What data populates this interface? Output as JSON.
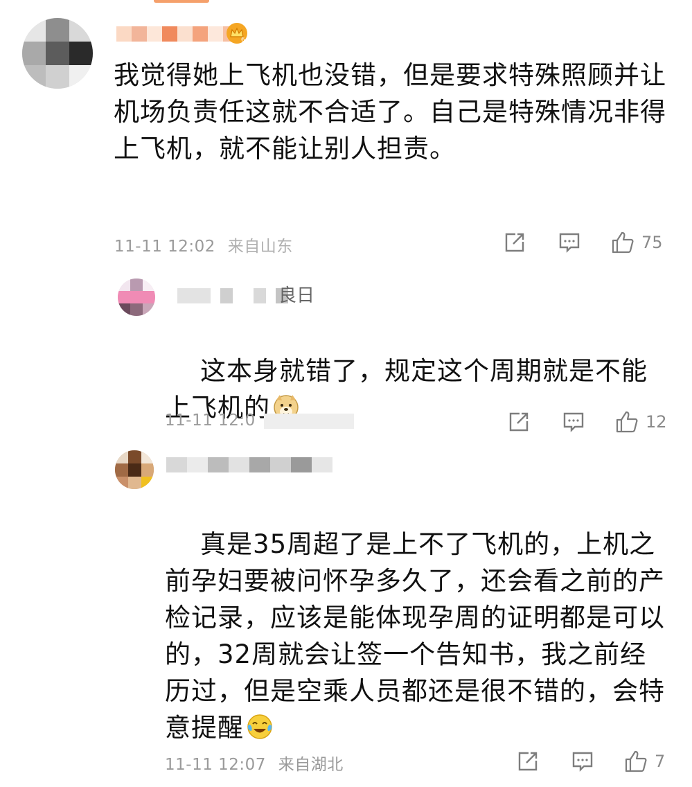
{
  "comments": [
    {
      "text": "我觉得她上飞机也没错，但是要求特殊照顾并让机场负责任这就不合适了。自己是特殊情况非得上飞机，就不能让别人担责。",
      "time": "11-11 12:02",
      "location": "来自山东",
      "likes": "75"
    },
    {
      "name_visible": "良日",
      "text": "这本身就错了，规定这个周期就是不能上飞机的",
      "emoji": "doge-emoji",
      "time": "11-11 12:0",
      "likes": "12"
    },
    {
      "text": "真是35周超了是上不了飞机的，上机之前孕妇要被问怀孕多久了，还会看之前的产检记录，应该是能体现孕周的证明都是可以的，32周就会让签一个告知书，我之前经历过，但是空乘人员都还是很不错的，会特意提醒",
      "emoji": "laugh-cry-emoji",
      "time": "11-11 12:07",
      "location": "来自湖北",
      "likes": "7"
    }
  ],
  "icons": {
    "share": "share-icon",
    "comment": "comment-icon",
    "like": "thumbs-up-icon",
    "badge": "crown-badge-icon"
  },
  "colors": {
    "text": "#111111",
    "meta": "#9a9a9a",
    "icon": "#7d7d7d"
  }
}
